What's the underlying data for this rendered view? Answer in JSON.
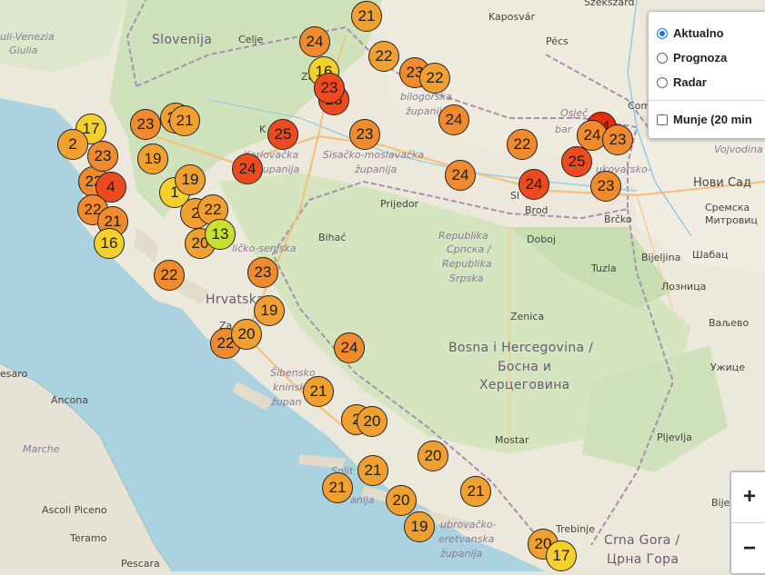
{
  "layers": {
    "options": [
      {
        "label": "Aktualno",
        "selected": true
      },
      {
        "label": "Prognoza",
        "selected": false
      },
      {
        "label": "Radar",
        "selected": false
      }
    ],
    "lightning_label": "Munje (20 min",
    "lightning_checked": false
  },
  "zoom": {
    "in_label": "+",
    "out_label": "−"
  },
  "map_labels": {
    "slovenija": "Slovenija",
    "hrvatska": "Hrvatska",
    "bih_line1": "Bosna i Hercegovina /",
    "bih_line2": "Босна и",
    "bih_line3": "Херцеговина",
    "cg_line1": "Crna Gora /",
    "cg_line2": "Црна Гора",
    "rs_line1": "Republika",
    "rs_line2": "Српска /",
    "rs_line3": "Republika",
    "rs_line4": "Srpska",
    "fvg_line1": "uli-Venezia",
    "fvg_line2": "Giulia",
    "marche": "Marche",
    "vojvodina": "Vojvodina",
    "karlovacka": "Karlovačka",
    "karlovacka2": "županija",
    "sisacko": "Sisačko-moslavačka",
    "sisacko2": "županija",
    "bilogorska": "bilogorska",
    "bilogorska2": "županija",
    "osjecko": "Osječ",
    "licko": "ličko-senjska",
    "sibensko": "Šibensko",
    "sibensko2": "kninsk",
    "sibensko3": "župan",
    "dubrovacko": "ubrovačko-",
    "dubrovacko2": "eretvanska",
    "dubrovacko3": "županija",
    "splitsko": "Solit",
    "splitsko2": "anija",
    "vukovarsko": "ukovarsko-",
    "celje": "Celje",
    "kaposvar": "Kaposvár",
    "pecs": "Pécs",
    "szekszard": "Szekszárd",
    "novi_sad": "Нови Сад",
    "sremska": "Сремска",
    "mitrovica": "Митровиц",
    "brcko": "Brčko",
    "bijeljina": "Bijeljina",
    "sabac": "Шабац",
    "loznica": "Лозница",
    "tuzla": "Tuzla",
    "doboj": "Doboj",
    "zenica": "Zenica",
    "valjevo": "Ваљево",
    "uzice": "Ужице",
    "pljevlja": "Pljevlja",
    "mostar": "Mostar",
    "trebinje": "Trebinje",
    "bijelo_polje": "Bijelo Pol",
    "prijedor": "Prijedor",
    "bihac": "Bihać",
    "brod": "Brod",
    "slavonski": "Sl",
    "ancona": "Ancona",
    "pesaro": "esaro",
    "ascoli": "Ascoli Piceno",
    "teramo": "Teramo",
    "pescara": "Pescara",
    "zagreb": "Za",
    "karlovac": "K",
    "com": "Com",
    "zadar": "Za",
    "osijek2": "bar"
  },
  "markers": [
    {
      "value": "21",
      "color": "#f0a030"
    },
    {
      "value": "24",
      "color": "#ef8a2e"
    },
    {
      "value": "16",
      "color": "#f4d02c"
    },
    {
      "value": "23",
      "color": "#ee4a20"
    },
    {
      "value": "23",
      "color": "#ee4a20"
    },
    {
      "value": "22",
      "color": "#f0a030"
    },
    {
      "value": "23",
      "color": "#ef8a2e"
    },
    {
      "value": "22",
      "color": "#f0a030"
    },
    {
      "value": "24",
      "color": "#ef8a2e"
    },
    {
      "value": "23",
      "color": "#ef8a2e"
    },
    {
      "value": "25",
      "color": "#ee4a20"
    },
    {
      "value": "24",
      "color": "#ee4a20"
    },
    {
      "value": "22",
      "color": "#ef8a2e"
    },
    {
      "value": "24",
      "color": "#e82a10"
    },
    {
      "value": "25",
      "color": "#ee4a20"
    },
    {
      "value": "24",
      "color": "#ef8a2e"
    },
    {
      "value": "23",
      "color": "#ef8a2e"
    },
    {
      "value": "24",
      "color": "#ef8a2e"
    },
    {
      "value": "24",
      "color": "#ee4a20"
    },
    {
      "value": "23",
      "color": "#ef8a2e"
    },
    {
      "value": "23",
      "color": "#f0a030"
    },
    {
      "value": "21",
      "color": "#f0a030"
    },
    {
      "value": "17",
      "color": "#f4d02c"
    },
    {
      "value": "2",
      "color": "#f0a030"
    },
    {
      "value": "23",
      "color": "#ef8a2e"
    },
    {
      "value": "22",
      "color": "#ef8a2e"
    },
    {
      "value": "4",
      "color": "#ee4a20"
    },
    {
      "value": "23",
      "color": "#ef8a2e"
    },
    {
      "value": "19",
      "color": "#f0a030"
    },
    {
      "value": "1",
      "color": "#f4d02c"
    },
    {
      "value": "19",
      "color": "#f0a030"
    },
    {
      "value": "22",
      "color": "#ef8a2e"
    },
    {
      "value": "2",
      "color": "#f0a030"
    },
    {
      "value": "22",
      "color": "#f0a030"
    },
    {
      "value": "21",
      "color": "#ef8a2e"
    },
    {
      "value": "16",
      "color": "#f4d02c"
    },
    {
      "value": "20",
      "color": "#f0a030"
    },
    {
      "value": "13",
      "color": "#c8e030"
    },
    {
      "value": "22",
      "color": "#ef8a2e"
    },
    {
      "value": "23",
      "color": "#ef8a2e"
    },
    {
      "value": "19",
      "color": "#f0a030"
    },
    {
      "value": "22",
      "color": "#ef8a2e"
    },
    {
      "value": "20",
      "color": "#f0a030"
    },
    {
      "value": "24",
      "color": "#ef8a2e"
    },
    {
      "value": "21",
      "color": "#f0a030"
    },
    {
      "value": "2",
      "color": "#f0a030"
    },
    {
      "value": "20",
      "color": "#f0a030"
    },
    {
      "value": "20",
      "color": "#f0a030"
    },
    {
      "value": "21",
      "color": "#f0a030"
    },
    {
      "value": "21",
      "color": "#f0a030"
    },
    {
      "value": "20",
      "color": "#f0a030"
    },
    {
      "value": "21",
      "color": "#f0a030"
    },
    {
      "value": "19",
      "color": "#f0a030"
    },
    {
      "value": "20",
      "color": "#f0a030"
    },
    {
      "value": "17",
      "color": "#f4d02c"
    }
  ]
}
